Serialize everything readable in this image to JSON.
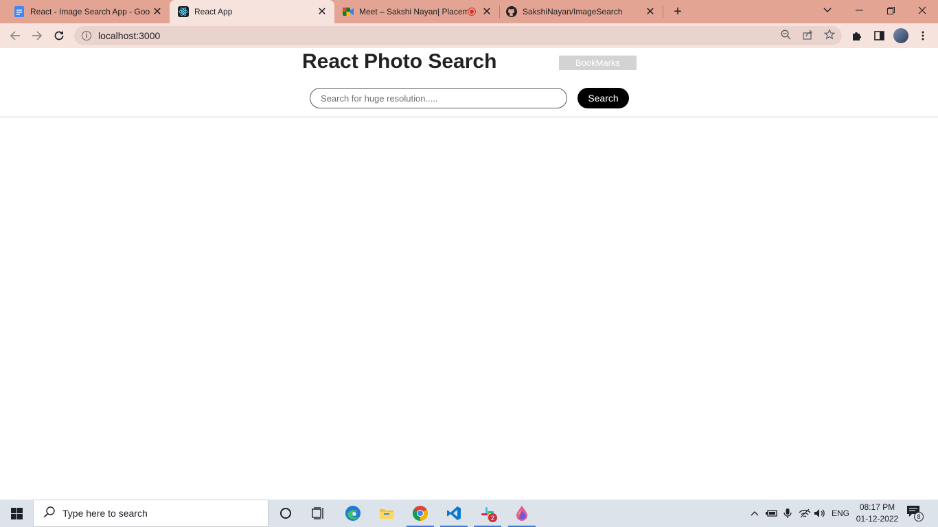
{
  "browser": {
    "tabs": [
      {
        "title": "React - Image Search App - Goog",
        "active": false
      },
      {
        "title": "React App",
        "active": true
      },
      {
        "title": "Meet – Sakshi Nayan| Placem",
        "active": false
      },
      {
        "title": "SakshiNayan/ImageSearch",
        "active": false
      }
    ],
    "address": "localhost:3000"
  },
  "app": {
    "title": "React Photo Search",
    "bookmarks_label": "BookMarks",
    "search_placeholder": "Search for huge resolution.....",
    "search_button_label": "Search"
  },
  "taskbar": {
    "search_placeholder": "Type here to search",
    "language": "ENG",
    "time": "08:17 PM",
    "date": "01-12-2022",
    "slack_badge": "2",
    "notification_count": "8"
  },
  "colors": {
    "tabstrip": "#e3a494",
    "active_tab": "#f7e3de",
    "search_button": "#000000",
    "bookmarks_button": "#d3d3d3"
  }
}
